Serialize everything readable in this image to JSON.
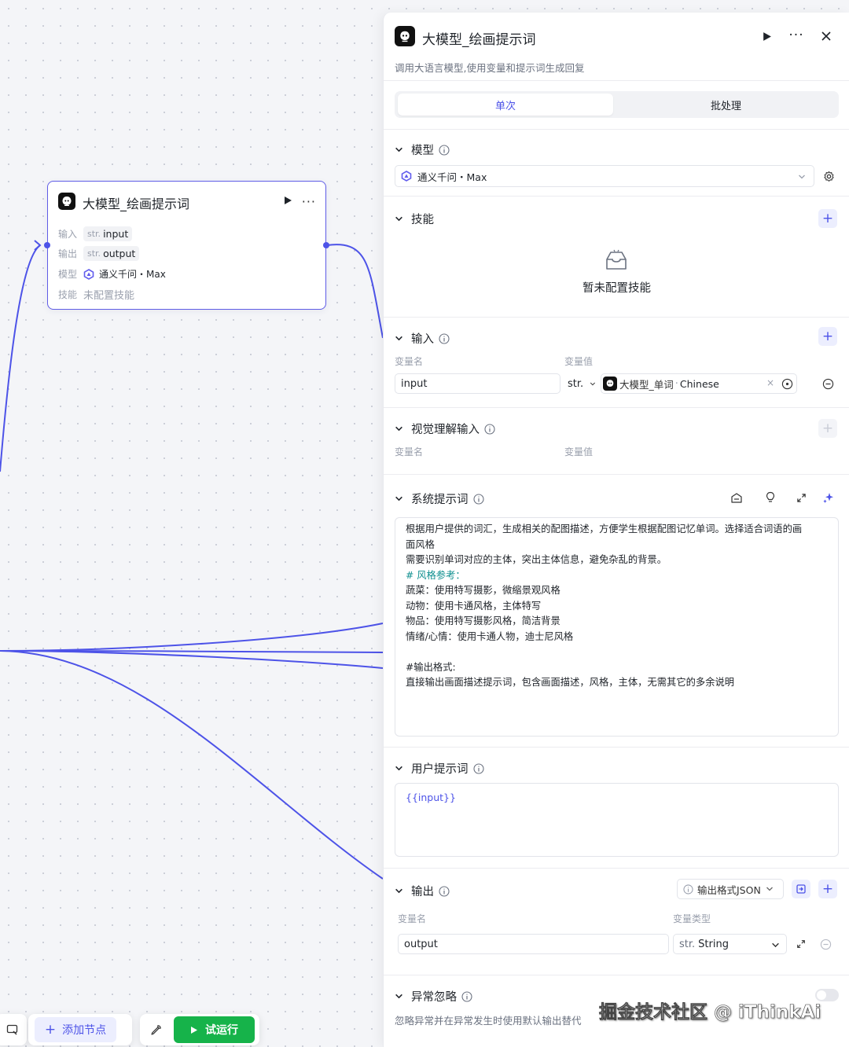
{
  "canvas_node": {
    "title": "大模型_绘画提示词",
    "input_label": "输入",
    "input_type": "str.",
    "input_value": "input",
    "output_label": "输出",
    "output_type": "str.",
    "output_value": "output",
    "model_label": "模型",
    "model_value": "通义千问・Max",
    "skill_label": "技能",
    "skill_value": "未配置技能"
  },
  "panel": {
    "title": "大模型_绘画提示词",
    "description": "调用大语言模型,使用变量和提示词生成回复",
    "tabs": {
      "single": "单次",
      "batch": "批处理"
    },
    "model": {
      "section": "模型",
      "selected": "通义千问・Max"
    },
    "skills": {
      "section": "技能",
      "empty": "暂未配置技能"
    },
    "input": {
      "section": "输入",
      "col_name": "变量名",
      "col_value": "变量值",
      "var_name": "input",
      "var_type": "str.",
      "ref_node": "大模型_单词",
      "ref_field": "Chinese"
    },
    "vision_input": {
      "section": "视觉理解输入",
      "col_name": "变量名",
      "col_value": "变量值"
    },
    "system_prompt": {
      "section": "系统提示词",
      "lines": [
        "根据用户提供的词汇，生成相关的配图描述，方便学生根据配图记忆单词。选择适合词语的画",
        "面风格",
        "需要识别单词对应的主体，突出主体信息，避免杂乱的背景。",
        "# 风格参考：",
        "蔬菜：使用特写摄影，微缩景观风格",
        "动物：使用卡通风格，主体特写",
        "物品：使用特写摄影风格，简洁背景",
        "情绪/心情：使用卡通人物，迪士尼风格",
        "",
        "#输出格式:",
        "直接输出画面描述提示词，包含画面描述，风格，主体，无需其它的多余说明"
      ]
    },
    "user_prompt": {
      "section": "用户提示词",
      "value": "{{input}}"
    },
    "output": {
      "section": "输出",
      "format_label": "输出格式JSON",
      "col_name": "变量名",
      "col_type": "变量类型",
      "var_name": "output",
      "type_prefix": "str.",
      "type_value": "String"
    },
    "exception": {
      "section": "异常忽略",
      "description": "忽略异常并在异常发生时使用默认输出替代"
    }
  },
  "toolbar": {
    "add_node": "添加节点",
    "test_run": "试运行"
  },
  "watermark": "掘金技术社区 @ iThinkAi",
  "colors": {
    "accent": "#4d53e8",
    "run_green": "#16b34a",
    "edge": "#4d53e8"
  }
}
